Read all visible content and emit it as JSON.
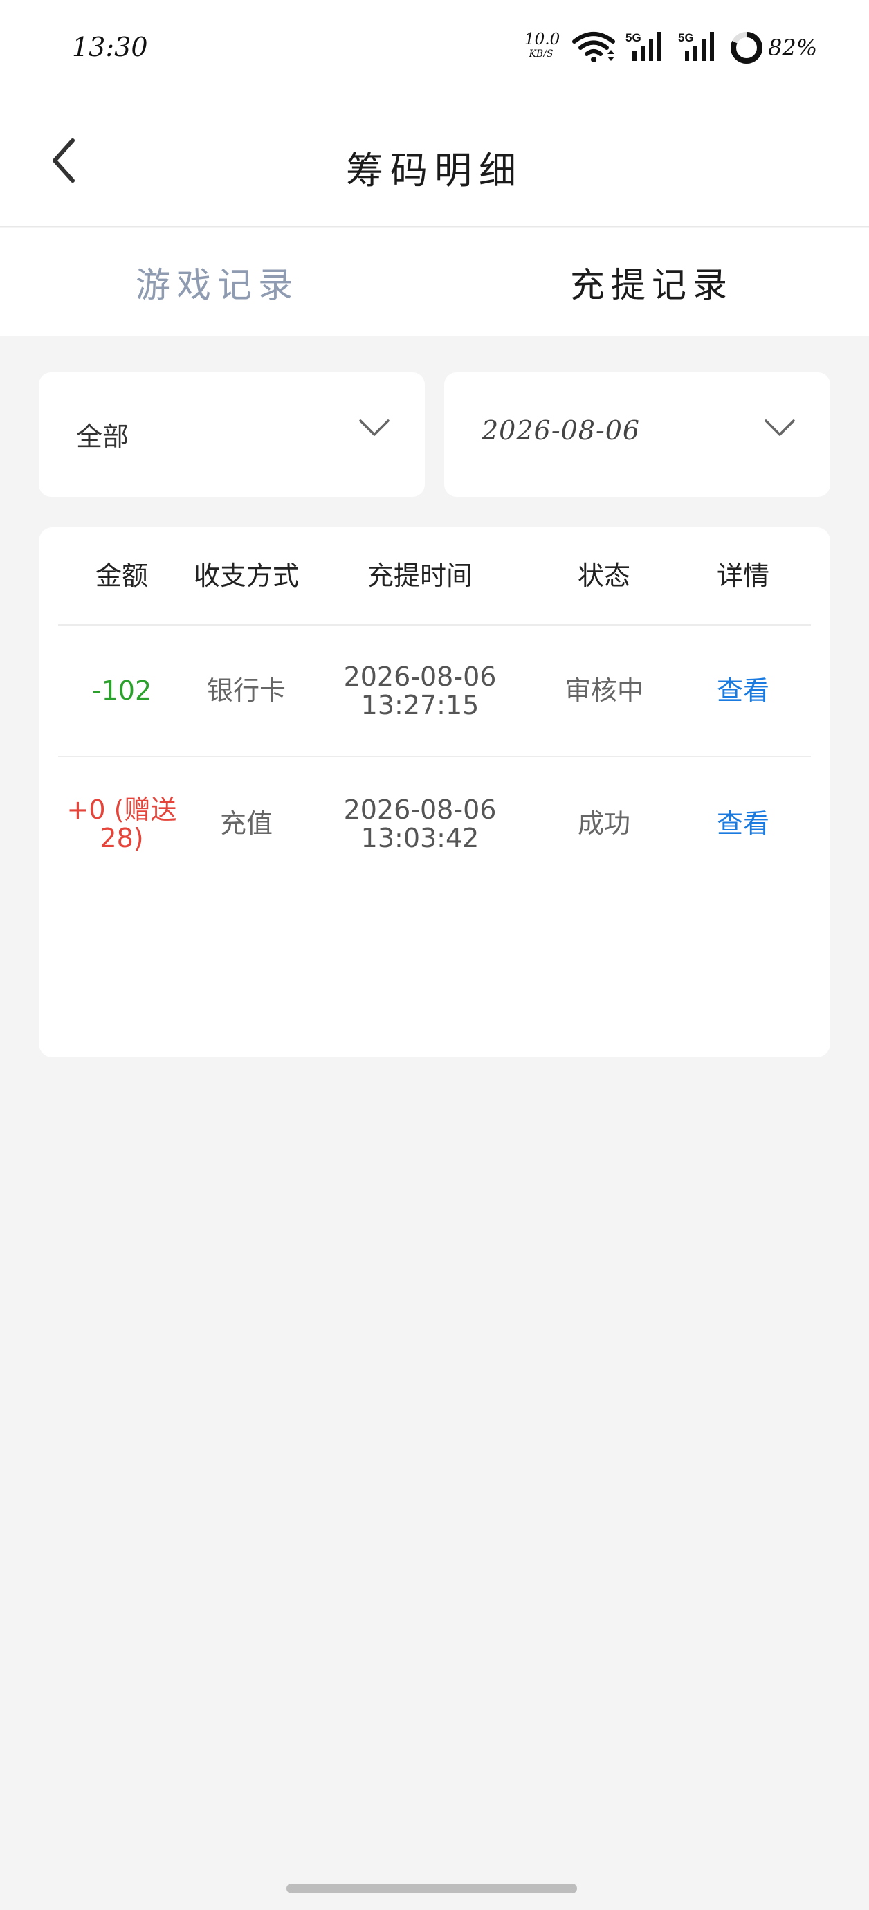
{
  "status_bar": {
    "time": "13:30",
    "net_speed_value": "10.0",
    "net_speed_unit": "KB/S",
    "network_label": "5G",
    "battery_percent": "82%",
    "battery_level": 0.82
  },
  "header": {
    "title": "筹码明细",
    "back_icon": "chevron-left-icon"
  },
  "tabs": [
    {
      "label": "游戏记录",
      "active": false
    },
    {
      "label": "充提记录",
      "active": true
    }
  ],
  "filters": {
    "type": {
      "value": "全部"
    },
    "date": {
      "value": "2026-08-06"
    }
  },
  "table": {
    "columns": [
      "金额",
      "收支方式",
      "充提时间",
      "状态",
      "详情"
    ],
    "rows": [
      {
        "amount": "-102",
        "method": "银行卡",
        "date": "2026-08-06",
        "time": "13:27:15",
        "status": "审核中",
        "detail": "查看"
      },
      {
        "amount": "+0 (赠送28)",
        "method": "充值",
        "date": "2026-08-06",
        "time": "13:03:42",
        "status": "成功",
        "detail": "查看"
      }
    ]
  },
  "colors": {
    "negative_amount": "#2aa12a",
    "positive_amount": "#e5443a",
    "link": "#1a7ae0",
    "inactive_tab": "#8e9bb0",
    "background": "#f4f4f4"
  }
}
